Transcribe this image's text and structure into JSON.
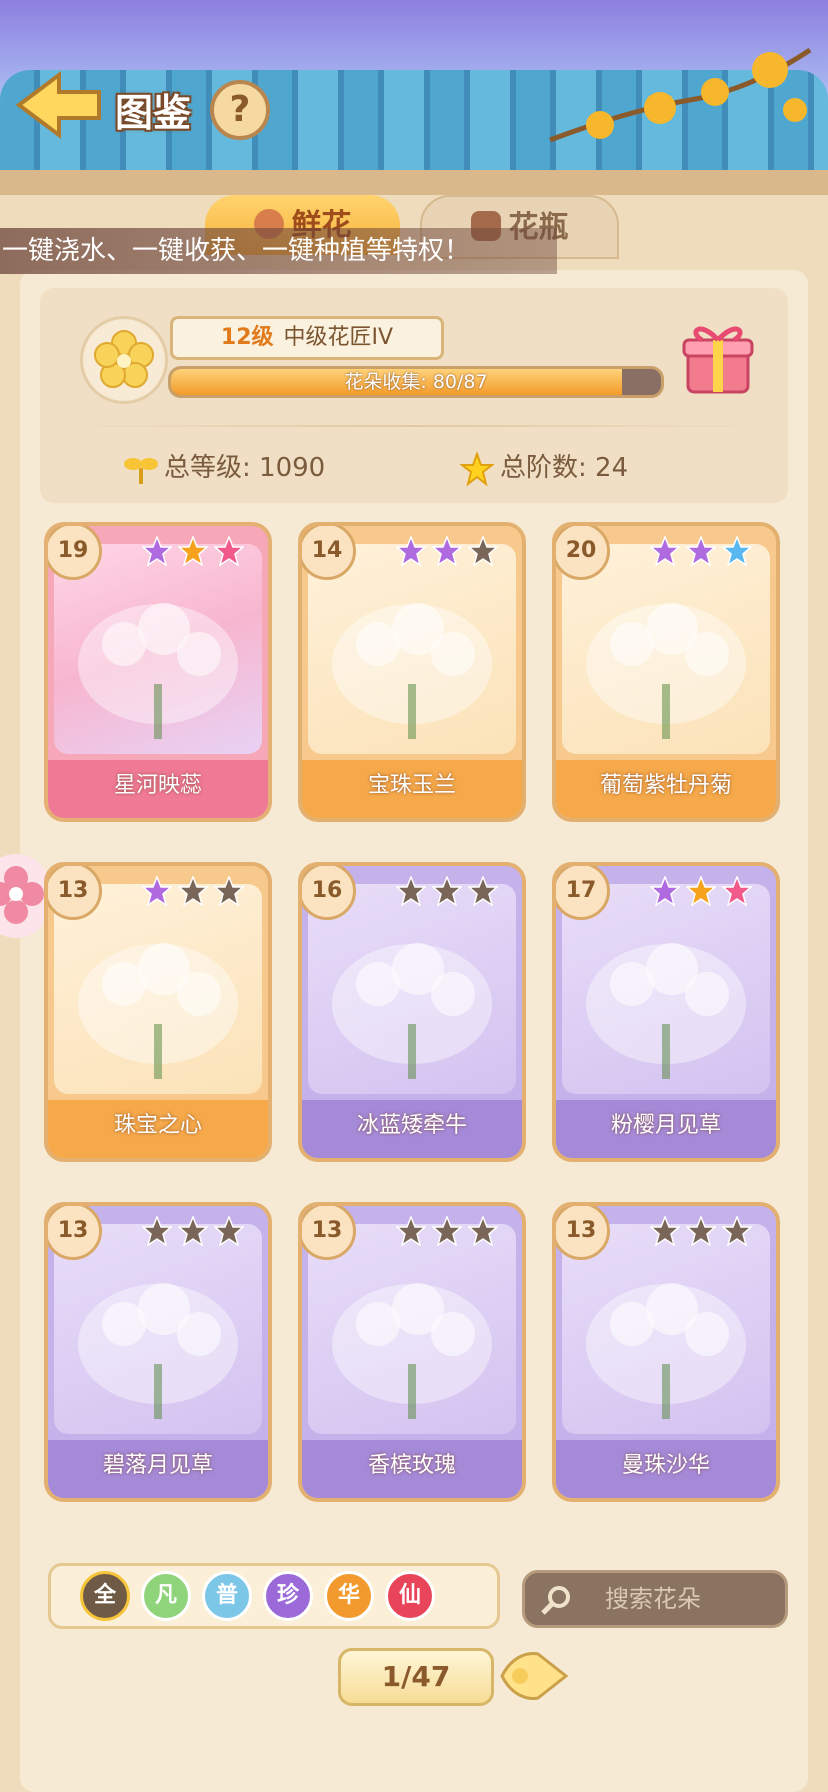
{
  "header": {
    "title": "图鉴",
    "help_label": "?"
  },
  "tabs": [
    {
      "label": "鲜花"
    },
    {
      "label": "花瓶"
    }
  ],
  "marquee": "一键浇水、一键收获、一键种植等特权！",
  "summary": {
    "level_num": "12级",
    "level_title": "中级花匠IV",
    "progress_label": "花朵收集: 80/87",
    "progress": 0.9195,
    "total_level": "总等级: 1090",
    "total_stage": "总阶数: 24"
  },
  "cards": [
    {
      "level": "19",
      "name": "星河映蕊",
      "theme": "pink",
      "stars": [
        "#b06ae0",
        "#f7a21c",
        "#f25a8c"
      ]
    },
    {
      "level": "14",
      "name": "宝珠玉兰",
      "theme": "orange",
      "stars": [
        "#b06ae0",
        "#b06ae0",
        "#7a6658"
      ]
    },
    {
      "level": "20",
      "name": "葡萄紫牡丹菊",
      "theme": "orange",
      "stars": [
        "#b06ae0",
        "#b06ae0",
        "#5ab8f0"
      ]
    },
    {
      "level": "13",
      "name": "珠宝之心",
      "theme": "orange",
      "stars": [
        "#b06ae0",
        "#7a6658",
        "#7a6658"
      ]
    },
    {
      "level": "16",
      "name": "冰蓝矮牵牛",
      "theme": "purple",
      "stars": [
        "#7a6658",
        "#7a6658",
        "#7a6658"
      ]
    },
    {
      "level": "17",
      "name": "粉樱月见草",
      "theme": "purple",
      "stars": [
        "#b06ae0",
        "#f7a21c",
        "#f25a8c"
      ]
    },
    {
      "level": "13",
      "name": "碧落月见草",
      "theme": "purple",
      "stars": [
        "#7a6658",
        "#7a6658",
        "#7a6658"
      ]
    },
    {
      "level": "13",
      "name": "香槟玫瑰",
      "theme": "purple",
      "stars": [
        "#7a6658",
        "#7a6658",
        "#7a6658"
      ]
    },
    {
      "level": "13",
      "name": "曼珠沙华",
      "theme": "purple",
      "stars": [
        "#7a6658",
        "#7a6658",
        "#7a6658"
      ]
    }
  ],
  "filters": [
    {
      "label": "全",
      "color": "#6e5a45"
    },
    {
      "label": "凡",
      "color": "#8fd47a"
    },
    {
      "label": "普",
      "color": "#7cc6e8"
    },
    {
      "label": "珍",
      "color": "#9b6ad8"
    },
    {
      "label": "华",
      "color": "#f29a2e"
    },
    {
      "label": "仙",
      "color": "#e8445a"
    }
  ],
  "search": {
    "placeholder": "搜索花朵"
  },
  "pager": {
    "label": "1/47"
  },
  "colors": {
    "accent": "#f7b33b",
    "card_pink": "#f6a8b8",
    "card_orange": "#f7c98d",
    "card_purple": "#c6b2ea"
  }
}
